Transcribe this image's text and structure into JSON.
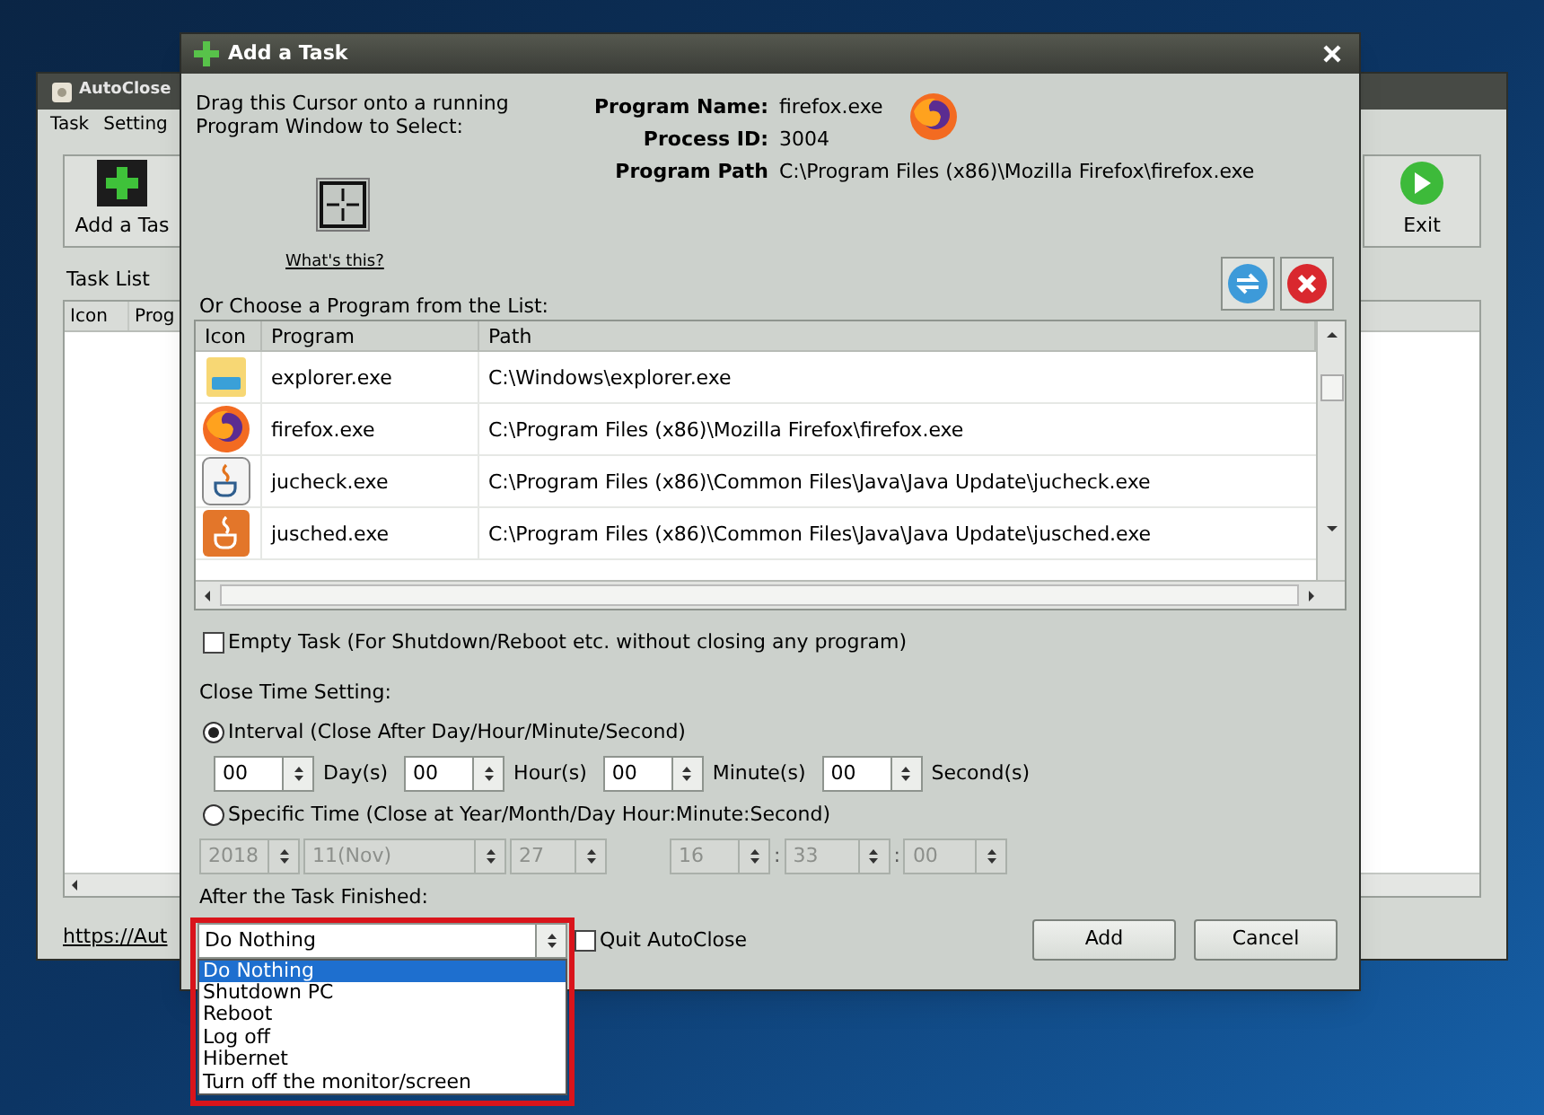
{
  "desktop_window": {
    "title": "AutoClose",
    "menu": [
      "Task",
      "Setting"
    ],
    "toolbar": [
      {
        "kind": "add",
        "label": "Add a Tas"
      },
      {
        "kind": "exit",
        "label": "Exit"
      }
    ],
    "task_list_label": "Task List",
    "columns": [
      "Icon",
      "Prog"
    ],
    "link": "https://Aut"
  },
  "dialog": {
    "title": "Add a Task",
    "drag_hint": "Drag this Cursor onto a running Program Window to Select:",
    "whats_this": "What's this?",
    "program_info": [
      {
        "label": "Program Name:",
        "value": "firefox.exe"
      },
      {
        "label": "Process ID:",
        "value": "3004"
      },
      {
        "label": "Program Path",
        "value": "C:\\Program Files (x86)\\Mozilla Firefox\\firefox.exe"
      }
    ],
    "list_label": "Or Choose a Program from the List:",
    "program_table": {
      "columns": [
        "Icon",
        "Program",
        "Path"
      ],
      "rows": [
        {
          "kind": "folder",
          "program": "explorer.exe",
          "path": "C:\\Windows\\explorer.exe"
        },
        {
          "kind": "globe",
          "program": "firefox.exe",
          "path": "C:\\Program Files (x86)\\Mozilla Firefox\\firefox.exe"
        },
        {
          "kind": "cup",
          "program": "jucheck.exe",
          "path": "C:\\Program Files (x86)\\Common Files\\Java\\Java Update\\jucheck.exe"
        },
        {
          "kind": "cup-orange",
          "program": "jusched.exe",
          "path": "C:\\Program Files (x86)\\Common Files\\Java\\Java Update\\jusched.exe"
        }
      ]
    },
    "empty_task": {
      "label": "Empty Task (For Shutdown/Reboot etc. without closing any program)",
      "checked": false
    },
    "close_time": {
      "label": "Close Time Setting:",
      "modes": [
        {
          "label": "Interval (Close After Day/Hour/Minute/Second)",
          "selected": true,
          "fields": [
            {
              "value": "00",
              "unit": "Day(s)"
            },
            {
              "value": "00",
              "unit": "Hour(s)"
            },
            {
              "value": "00",
              "unit": "Minute(s)"
            },
            {
              "value": "00",
              "unit": "Second(s)"
            }
          ]
        },
        {
          "label": "Specific Time (Close at Year/Month/Day Hour:Minute:Second)",
          "selected": false,
          "fields": [
            {
              "value": "2018"
            },
            {
              "value": "11(Nov)"
            },
            {
              "value": "27"
            },
            {
              "value": "16"
            },
            {
              "value": "33",
              "prefix": ":"
            },
            {
              "value": "00",
              "prefix": ":"
            }
          ]
        }
      ]
    },
    "after_finish": {
      "label": "After the Task Finished:",
      "value": "Do Nothing",
      "expanded": true,
      "options": [
        {
          "label": "Do Nothing",
          "selected": true
        },
        {
          "label": "Shutdown PC",
          "selected": false
        },
        {
          "label": "Reboot",
          "selected": false
        },
        {
          "label": "Log off",
          "selected": false
        },
        {
          "label": "Hibernet",
          "selected": false
        },
        {
          "label": "Turn off the monitor/screen",
          "selected": false
        }
      ]
    },
    "quit": {
      "label": "Quit AutoClose",
      "checked": false
    },
    "buttons": [
      "Add",
      "Cancel"
    ]
  }
}
